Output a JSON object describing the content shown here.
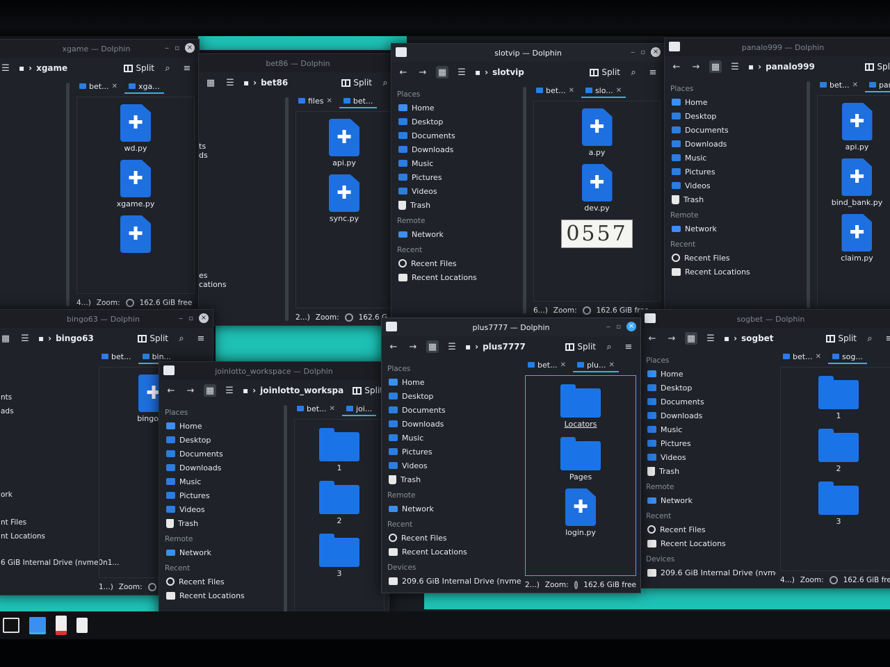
{
  "windows": {
    "xgame": {
      "title": "xgame — Dolphin",
      "path": "xgame",
      "split": "Split",
      "tabs": [
        "bet...",
        "xga..."
      ],
      "files": [
        "wd.py",
        "xgame.py",
        ""
      ],
      "status_count": "4...)",
      "zoom": "Zoom:",
      "free": "162.6 GiB free"
    },
    "bet86": {
      "title": "bet86 — Dolphin",
      "path": "bet86",
      "split": "Split",
      "tabs": [
        "files",
        "bet..."
      ],
      "files": [
        "api.py",
        "sync.py"
      ],
      "status_count": "2...)",
      "zoom": "Zoom:",
      "free": "162.6 G"
    },
    "slotvip": {
      "title": "slotvip — Dolphin",
      "path": "slotvip",
      "split": "Split",
      "tabs": [
        "bet...",
        "slo..."
      ],
      "files": [
        "a.py",
        "dev.py"
      ],
      "captcha": "0557",
      "status_count": "6...)",
      "zoom": "Zoom:",
      "free": "162.6 GiB free"
    },
    "panalo999": {
      "title": "panalo999 — Dolphin",
      "path": "panalo999",
      "split": "Split",
      "tabs": [
        "bet...",
        "pan"
      ],
      "files": [
        "api.py",
        "bind_bank.py",
        "claim.py"
      ]
    },
    "bingo63": {
      "title": "bingo63 — Dolphin",
      "path": "bingo63",
      "split": "Split",
      "tabs": [
        "bet...",
        "bin..."
      ],
      "files": [
        "bingo.py"
      ],
      "status_count": "1...)",
      "zoom": "Zoom:",
      "drive": "209.6 GiB Internal Drive (nvme0n1..."
    },
    "joinlotto": {
      "title": "joinlotto_workspace — Dolphin",
      "path": "joinlotto_workspa",
      "split": "Split",
      "tabs": [
        "bet...",
        "joi..."
      ],
      "files": [
        "1",
        "2",
        "3"
      ]
    },
    "plus7777": {
      "title": "plus7777 — Dolphin",
      "path": "plus7777",
      "split": "Split",
      "tabs": [
        "bet...",
        "plu..."
      ],
      "files": [
        "Locators",
        "Pages",
        "login.py"
      ],
      "status_count": "2...)",
      "zoom": "Zoom:",
      "free": "162.6 GiB free"
    },
    "sogbet": {
      "title": "sogbet — Dolphin",
      "path": "sogbet",
      "split": "Split",
      "tabs": [
        "bet...",
        "sog..."
      ],
      "files": [
        "1",
        "2",
        "3"
      ],
      "status_count": "4...)",
      "zoom": "Zoom:",
      "free": "162.6 GiB free"
    }
  },
  "places": {
    "heading": "Places",
    "home": "Home",
    "desktop": "Desktop",
    "documents": "Documents",
    "downloads": "Downloads",
    "music": "Music",
    "pictures": "Pictures",
    "videos": "Videos",
    "trash": "Trash",
    "remote": "Remote",
    "network": "Network",
    "recent": "Recent",
    "recent_files": "Recent Files",
    "recent_locations": "Recent Locations",
    "devices": "Devices",
    "drive": "209.6 GiB Internal Drive (nvme0n1..."
  },
  "fragments": {
    "a": "ts",
    "b": "ds",
    "c": "es",
    "d": "cations",
    "e": "ations",
    "f": "nts",
    "g": "ads",
    "h": "ork",
    "i": "nt Files",
    "j": "nt Locations",
    "k": "6 GiB Internal Drive (nvme0n1..."
  },
  "colors": {
    "accent": "#3daee9",
    "folder": "#1a74e8",
    "teal_desktop": "#1fc2b6",
    "window_bg": "#1f2228"
  }
}
